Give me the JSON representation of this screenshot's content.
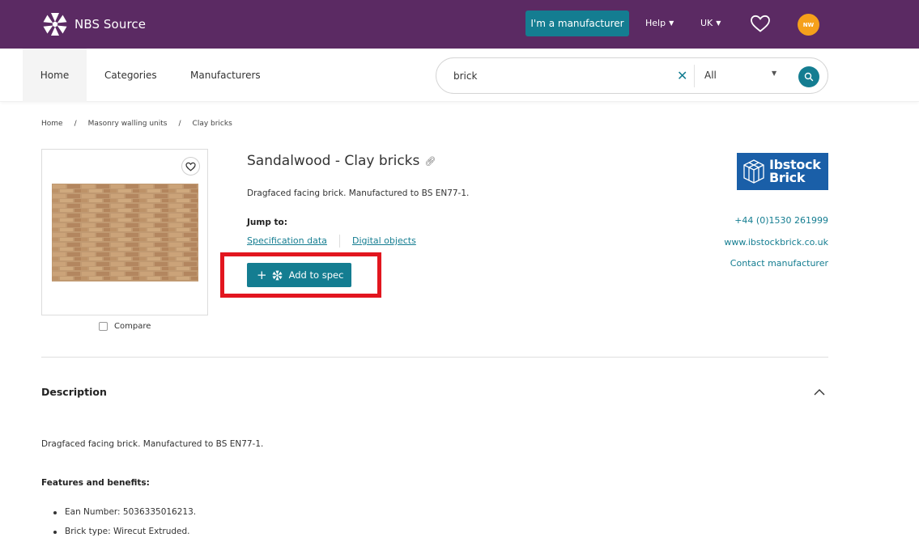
{
  "header": {
    "brand": "NBS Source",
    "manufacturer_button": "I'm a manufacturer",
    "help": "Help",
    "region": "UK",
    "avatar_initials": "NW",
    "bar_color": "#5b2a63",
    "accent_color": "#147d91"
  },
  "nav": {
    "items": [
      "Home",
      "Categories",
      "Manufacturers"
    ],
    "search": {
      "value": "brick",
      "clear_icon": "close-icon",
      "scope": "All",
      "submit_icon": "search-icon"
    }
  },
  "breadcrumb": [
    "Home",
    "Masonry walling units",
    "Clay bricks"
  ],
  "breadcrumb_separator": "/",
  "product": {
    "title": "Sandalwood - Clay bricks",
    "description": "Dragfaced facing brick. Manufactured to BS EN77-1.",
    "jump_to_label": "Jump to:",
    "jump_links": [
      "Specification data",
      "Digital objects"
    ],
    "add_to_spec": "Add to spec",
    "compare_label": "Compare",
    "highlight_color": "#e2161f"
  },
  "manufacturer": {
    "logo_text_line1": "Ibstock",
    "logo_text_line2": "Brick",
    "logo_color": "#1a5fa8",
    "phone": "+44 (0)1530 261999",
    "website": "www.ibstockbrick.co.uk",
    "contact": "Contact manufacturer"
  },
  "description_section": {
    "heading": "Description",
    "text": "Dragfaced facing brick. Manufactured to BS EN77-1.",
    "features_heading": "Features and benefits:",
    "features": [
      "Ean Number: 5036335016213.",
      "Brick type: Wirecut Extruded."
    ]
  }
}
